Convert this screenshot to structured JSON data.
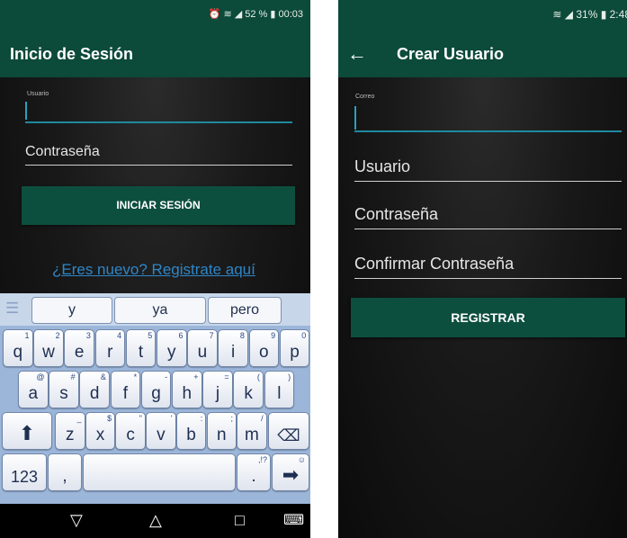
{
  "login_screen": {
    "status_bar": {
      "text": "⏰ ≋ ◢ 52 % ▮ 00:03"
    },
    "title": "Inicio de Sesión",
    "user_field": {
      "label": "Usuario"
    },
    "password_field": {
      "placeholder": "Contraseña"
    },
    "login_button": "INICIAR SESIÓN",
    "register_link": "¿Eres nuevo? Registrate aquí"
  },
  "keyboard": {
    "menu_icon": "☰",
    "suggestions": [
      "y",
      "ya",
      "pero"
    ],
    "rows": [
      [
        {
          "k": "q",
          "h": "1"
        },
        {
          "k": "w",
          "h": "2"
        },
        {
          "k": "e",
          "h": "3"
        },
        {
          "k": "r",
          "h": "4"
        },
        {
          "k": "t",
          "h": "5"
        },
        {
          "k": "y",
          "h": "6"
        },
        {
          "k": "u",
          "h": "7"
        },
        {
          "k": "i",
          "h": "8"
        },
        {
          "k": "o",
          "h": "9"
        },
        {
          "k": "p",
          "h": "0"
        }
      ],
      [
        {
          "k": "a",
          "h": "@"
        },
        {
          "k": "s",
          "h": "#"
        },
        {
          "k": "d",
          "h": "&"
        },
        {
          "k": "f",
          "h": "*"
        },
        {
          "k": "g",
          "h": "-"
        },
        {
          "k": "h",
          "h": "+"
        },
        {
          "k": "j",
          "h": "="
        },
        {
          "k": "k",
          "h": "("
        },
        {
          "k": "l",
          "h": ")"
        }
      ],
      [
        {
          "k": "z",
          "h": "_"
        },
        {
          "k": "x",
          "h": "$"
        },
        {
          "k": "c",
          "h": "\""
        },
        {
          "k": "v",
          "h": "'"
        },
        {
          "k": "b",
          "h": ":"
        },
        {
          "k": "n",
          "h": ";"
        },
        {
          "k": "m",
          "h": "/"
        }
      ]
    ],
    "shift": "⬆",
    "backspace": "⌫",
    "numbers_key": "123",
    "comma_key": ",",
    "space_key": "",
    "period_key": ".",
    "period_hint": ",!?",
    "enter_key": "➡",
    "enter_hint": "☺"
  },
  "nav_bar": {
    "back": "▽",
    "home": "△",
    "recents": "□",
    "keyboard": "⌨"
  },
  "register_screen": {
    "status_bar": {
      "text": "≋ ◢ 31% ▮ 2:48"
    },
    "back_arrow": "←",
    "title": "Crear Usuario",
    "email_field": {
      "label": "Correo"
    },
    "user_field": {
      "placeholder": "Usuario"
    },
    "password_field": {
      "placeholder": "Contraseña"
    },
    "confirm_field": {
      "placeholder": "Confirmar Contraseña"
    },
    "register_button": "REGISTRAR"
  }
}
